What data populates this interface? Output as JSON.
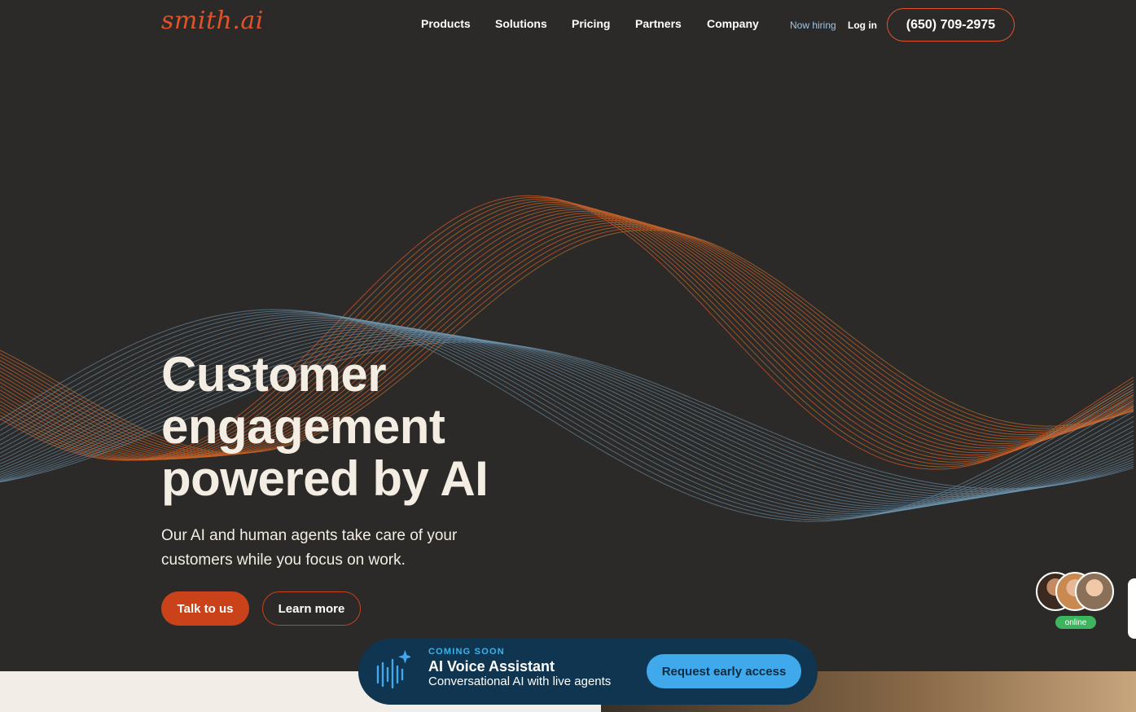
{
  "brand": {
    "logo_text": "smith.ai",
    "accent_color": "#e0532a",
    "primary_button_color": "#c9421a"
  },
  "nav": {
    "items": [
      {
        "label": "Products"
      },
      {
        "label": "Solutions"
      },
      {
        "label": "Pricing"
      },
      {
        "label": "Partners"
      },
      {
        "label": "Company"
      }
    ],
    "hiring_label": "Now hiring",
    "login_label": "Log in",
    "phone_label": "(650) 709-2975"
  },
  "hero": {
    "title_lines": [
      "Customer",
      "engagement",
      "powered by AI"
    ],
    "subtitle_lines": [
      "Our AI and  human agents take care of your",
      "customers while you focus on work."
    ],
    "primary_cta": "Talk to us",
    "secondary_cta": "Learn more"
  },
  "promo": {
    "eyebrow": "COMING SOON",
    "title": "AI Voice Assistant",
    "description": "Conversational AI with live agents",
    "cta": "Request early access",
    "icon": "voice-wave-sparkle-icon"
  },
  "chat_widget": {
    "status_label": "online",
    "status_color": "#3cb55e"
  }
}
